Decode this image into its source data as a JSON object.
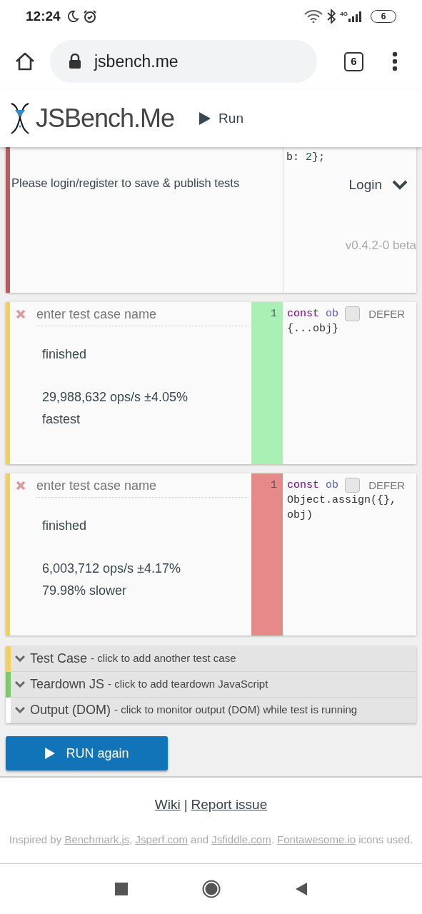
{
  "status_bar": {
    "time": "12:24",
    "network": "4G",
    "battery": "6"
  },
  "browser": {
    "url": "jsbench.me",
    "tab_count": "6"
  },
  "header": {
    "title": "JSBench.Me",
    "run_label": "Run"
  },
  "setup": {
    "message": "Please login/register to save & publish tests",
    "code": [
      {
        "kind": "plain",
        "text": "b: "
      },
      {
        "kind": "number",
        "text": "2"
      },
      {
        "kind": "plain",
        "text": "};"
      }
    ],
    "login_label": "Login",
    "version": "v0.4.2-0 beta"
  },
  "test_cases": [
    {
      "placeholder": "enter test case name",
      "status": "finished",
      "ops": "29,988,632 ops/s ±4.05%",
      "verdict": "fastest",
      "kind": "fastest",
      "line_number": "1",
      "code_lines": [
        [
          {
            "kind": "keyword",
            "text": "const "
          },
          {
            "kind": "def",
            "text": "ob"
          }
        ],
        [
          {
            "kind": "plain",
            "text": "{...obj}"
          }
        ]
      ],
      "defer_label": "DEFER",
      "defer_checked": false
    },
    {
      "placeholder": "enter test case name",
      "status": "finished",
      "ops": "6,003,712 ops/s ±4.17%",
      "verdict": "79.98% slower",
      "kind": "slower",
      "line_number": "1",
      "code_lines": [
        [
          {
            "kind": "keyword",
            "text": "const "
          },
          {
            "kind": "def",
            "text": "ob"
          }
        ],
        [
          {
            "kind": "plain",
            "text": "Object.assign({},"
          }
        ],
        [
          {
            "kind": "plain",
            "text": "obj)"
          }
        ]
      ],
      "defer_label": "DEFER",
      "defer_checked": false
    }
  ],
  "sections": [
    {
      "title": "Test Case",
      "hint": "- click to add another test case",
      "color": "#f0d060"
    },
    {
      "title": "Teardown JS",
      "hint": "- click to add teardown JavaScript",
      "color": "#7cc86a"
    },
    {
      "title": "Output (DOM)",
      "hint": "- click to monitor output (DOM) while test is running",
      "color": "#ffffff"
    }
  ],
  "run_button": "RUN again",
  "footer": {
    "links": [
      "Wiki",
      "Report issue"
    ],
    "separator": "|",
    "credits": [
      {
        "kind": "text",
        "text": "Inspired by "
      },
      {
        "kind": "link",
        "text": "Benchmark.js"
      },
      {
        "kind": "text",
        "text": ", "
      },
      {
        "kind": "link",
        "text": "Jsperf.com"
      },
      {
        "kind": "text",
        "text": " and "
      },
      {
        "kind": "link",
        "text": "Jsfiddle.com"
      },
      {
        "kind": "text",
        "text": ". "
      },
      {
        "kind": "link",
        "text": "Fontawesome.io"
      },
      {
        "kind": "text",
        "text": " icons used."
      }
    ]
  }
}
